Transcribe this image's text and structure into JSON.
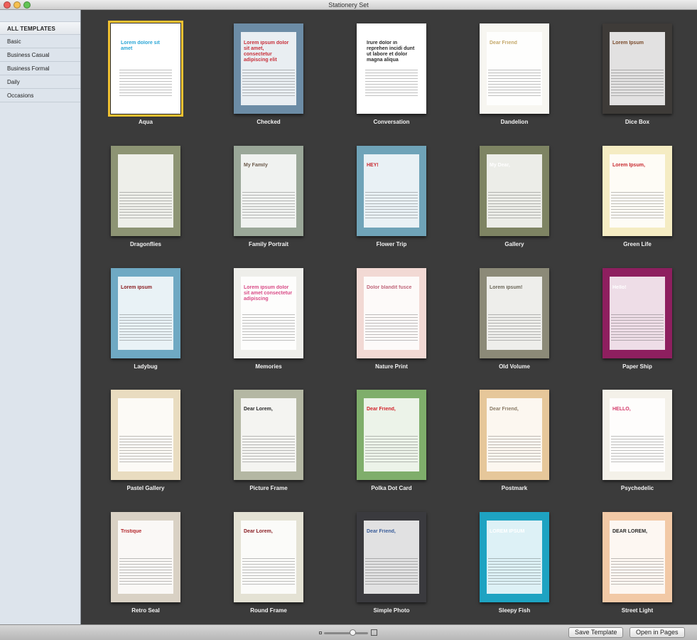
{
  "window": {
    "title": "Stationery Set"
  },
  "sidebar": {
    "items": [
      {
        "label": "ALL TEMPLATES"
      },
      {
        "label": "Basic"
      },
      {
        "label": "Business Casual"
      },
      {
        "label": "Business Formal"
      },
      {
        "label": "Daily"
      },
      {
        "label": "Occasions"
      }
    ]
  },
  "templates": [
    {
      "label": "Aqua",
      "text": "Lorem dolore sit amet",
      "bg": "#ffffff",
      "accent": "#2aa6d6",
      "selected": true
    },
    {
      "label": "Checked",
      "text": "Lorem ipsum dolor sit amet, consectetur adipiscing elit",
      "bg": "#6c8ca6",
      "accent": "#c8313b"
    },
    {
      "label": "Conversation",
      "text": "Irure dolor in reprehen incidi dunt ut labore et dolor magna aliqua",
      "bg": "#ffffff",
      "accent": "#2a2a2a"
    },
    {
      "label": "Dandelion",
      "text": "Dear Friend",
      "bg": "#f7f6f1",
      "accent": "#c5a96b"
    },
    {
      "label": "Dice Box",
      "text": "Lorem Ipsum",
      "bg": "#3e3b38",
      "accent": "#7a4a2a"
    },
    {
      "label": "Dragonflies",
      "text": "",
      "bg": "#8d9474",
      "accent": "#6fb9c9"
    },
    {
      "label": "Family Portrait",
      "text": "My Family",
      "bg": "#9aa798",
      "accent": "#6b5a4a"
    },
    {
      "label": "Flower Trip",
      "text": "HEY!",
      "bg": "#6fa3b8",
      "accent": "#c8282e"
    },
    {
      "label": "Gallery",
      "text": "My Dear,",
      "bg": "#7e8463",
      "accent": "#ffffff"
    },
    {
      "label": "Green Life",
      "text": "Lorem Ipsum,",
      "bg": "#f5ecc3",
      "accent": "#c8282e"
    },
    {
      "label": "Ladybug",
      "text": "Lorem ipsum",
      "bg": "#6fa9c3",
      "accent": "#8b1e22"
    },
    {
      "label": "Memories",
      "text": "Lorem ipsum dolor sit amet consectetur adipiscing",
      "bg": "#eeeeea",
      "accent": "#d94a86"
    },
    {
      "label": "Nature Print",
      "text": "Dolor blandit fusce",
      "bg": "#f2d9d4",
      "accent": "#c0667a"
    },
    {
      "label": "Old Volume",
      "text": "Lorem ipsum!",
      "bg": "#8c8a78",
      "accent": "#6a6658"
    },
    {
      "label": "Paper Ship",
      "text": "Hello!",
      "bg": "#8e1f5f",
      "accent": "#ffffff"
    },
    {
      "label": "Pastel Gallery",
      "text": "",
      "bg": "#e9dcc0",
      "accent": "#6a5a48"
    },
    {
      "label": "Picture Frame",
      "text": "Dear Lorem,",
      "bg": "#b4b7a3",
      "accent": "#2a2a2a"
    },
    {
      "label": "Polka Dot Card",
      "text": "Dear Friend,",
      "bg": "#7fae6b",
      "accent": "#d2232a"
    },
    {
      "label": "Postmark",
      "text": "Dear Friend,",
      "bg": "#e6c79a",
      "accent": "#8a7b66"
    },
    {
      "label": "Psychedelic",
      "text": "HELLO,",
      "bg": "#f4f1e9",
      "accent": "#d43a6a"
    },
    {
      "label": "Retro Seal",
      "text": "Tristique",
      "bg": "#d9d1c4",
      "accent": "#b3262b"
    },
    {
      "label": "Round Frame",
      "text": "Dear Lorem,",
      "bg": "#e4e2d4",
      "accent": "#8a1f25"
    },
    {
      "label": "Simple Photo",
      "text": "Dear Friend,",
      "bg": "#3a3a3e",
      "accent": "#3a5d9a"
    },
    {
      "label": "Sleepy Fish",
      "text": "LOREM IPSUM",
      "bg": "#1ea3c2",
      "accent": "#ffffff"
    },
    {
      "label": "Street Light",
      "text": "DEAR LOREM,",
      "bg": "#f2c9a6",
      "accent": "#2a2a2a"
    }
  ],
  "footer": {
    "save_template": "Save Template",
    "open_in_pages": "Open in Pages"
  }
}
